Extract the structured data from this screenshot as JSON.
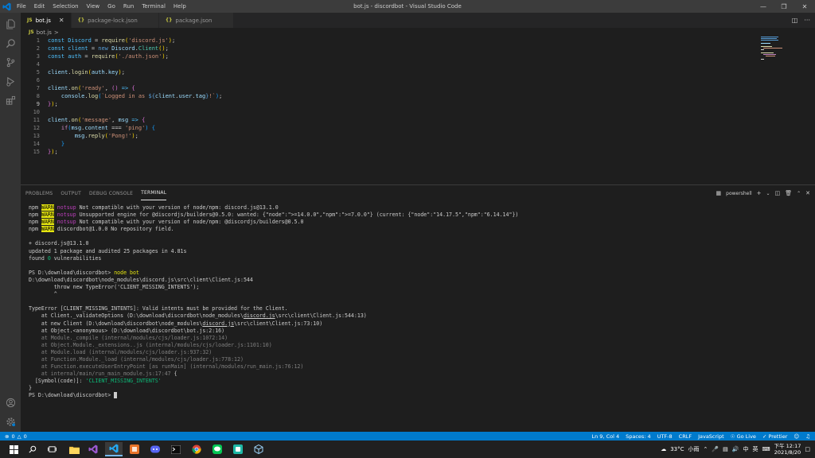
{
  "window": {
    "title": "bot.js - discordbot - Visual Studio Code",
    "menu": [
      "File",
      "Edit",
      "Selection",
      "View",
      "Go",
      "Run",
      "Terminal",
      "Help"
    ]
  },
  "tabs": [
    {
      "icon": "JS",
      "label": "bot.js",
      "active": true
    },
    {
      "icon": "{}",
      "label": "package-lock.json",
      "active": false
    },
    {
      "icon": "{}",
      "label": "package.json",
      "active": false
    }
  ],
  "breadcrumb": {
    "icon": "JS",
    "file": "bot.js",
    "separator": ">"
  },
  "editor": {
    "line_numbers": [
      "1",
      "2",
      "3",
      "4",
      "5",
      "6",
      "7",
      "8",
      "9",
      "10",
      "11",
      "12",
      "13",
      "14",
      "15"
    ],
    "active_line": 8
  },
  "panel": {
    "tabs": [
      "PROBLEMS",
      "OUTPUT",
      "DEBUG CONSOLE",
      "TERMINAL"
    ],
    "active_tab": "TERMINAL",
    "shell": "powershell",
    "terminal": {
      "npm": "npm",
      "warn": "WARN",
      "notsup": "notsup",
      "l1": " Not compatible with your version of node/npm: discord.js@13.1.0",
      "l2": " Unsupported engine for @discordjs/builders@0.5.0: wanted: {\"node\":\">=14.0.0\",\"npm\":\">=7.0.0\"} (current: {\"node\":\"14.17.5\",\"npm\":\"6.14.14\"})",
      "l3": " Not compatible with your version of node/npm: @discordjs/builders@0.5.0",
      "l4": " discordbot@1.0.0 No repository field.",
      "l5": "+ discord.js@13.1.0",
      "l6": "updated 1 package and audited 25 packages in 4.81s",
      "l7a": "found ",
      "l7b": "0",
      "l7c": " vulnerabilities",
      "l8a": "PS D:\\download\\discordbot> ",
      "l8b": "node bot",
      "l9": "D:\\download\\discordbot\\node_modules\\discord.js\\src\\client\\Client.js:544",
      "l10": "        throw new TypeError('CLIENT_MISSING_INTENTS');",
      "l11": "        ^",
      "l12": "TypeError [CLIENT_MISSING_INTENTS]: Valid intents must be provided for the Client.",
      "l13a": "    at Client._validateOptions (D:\\download\\discordbot\\node_modules\\",
      "l13b": "discord.js",
      "l13c": "\\src\\client\\Client.js:544:13)",
      "l14a": "    at new Client (D:\\download\\discordbot\\node_modules\\",
      "l14b": "discord.js",
      "l14c": "\\src\\client\\Client.js:73:10)",
      "l15": "    at Object.<anonymous> (D:\\download\\discordbot\\bot.js:2:16)",
      "l16": "    at Module._compile (internal/modules/cjs/loader.js:1072:14)",
      "l17": "    at Object.Module._extensions..js (internal/modules/cjs/loader.js:1101:10)",
      "l18": "    at Module.load (internal/modules/cjs/loader.js:937:32)",
      "l19": "    at Function.Module._load (internal/modules/cjs/loader.js:778:12)",
      "l20": "    at Function.executeUserEntryPoint [as runMain] (internal/modules/run_main.js:76:12)",
      "l21a": "    at internal/main/run_main_module.js:17:47",
      "l21b": " {",
      "l22a": "  [Symbol(code)]: ",
      "l22b": "'CLIENT_MISSING_INTENTS'",
      "l23": "}",
      "l24": "PS D:\\download\\discordbot> "
    }
  },
  "statusbar": {
    "errors": "0",
    "warnings": "0",
    "position": "Ln 9, Col 4",
    "spaces": "Spaces: 4",
    "encoding": "UTF-8",
    "eol": "CRLF",
    "language": "JavaScript",
    "golive": "Go Live",
    "prettier": "Prettier"
  },
  "taskbar": {
    "temperature": "33°C",
    "weather": "小雨",
    "input_method": "中",
    "lang": "英",
    "time": "下午 12:17",
    "date": "2021/8/20"
  },
  "colors": {
    "statusbar": "#007acc",
    "accent": "#007acc",
    "titlebar": "#3c3c3c"
  },
  "icons": [
    "vscode-icon",
    "explorer-icon",
    "search-icon",
    "source-control-icon",
    "run-debug-icon",
    "extensions-icon",
    "account-icon",
    "settings-gear-icon"
  ]
}
